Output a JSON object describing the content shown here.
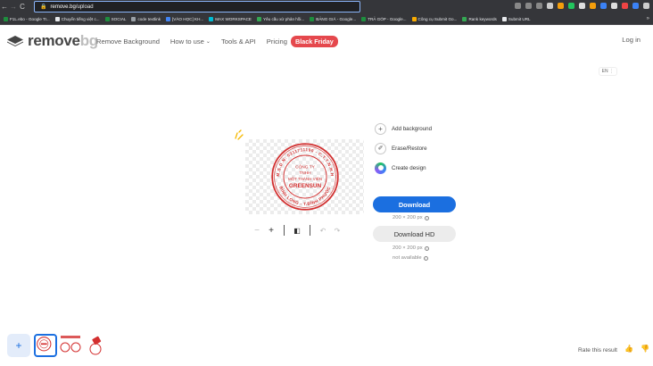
{
  "browser": {
    "url_host": "remove.bg",
    "url_path": "/upload",
    "bookmarks": [
      {
        "label": "F1L.ebo - Google Tr...",
        "color": "#1e8e3e"
      },
      {
        "label": "Chuyển tiếng việt c...",
        "color": "#e8eaed"
      },
      {
        "label": "SOCIAL",
        "color": "#1e8e3e"
      },
      {
        "label": "code textlink",
        "color": "#9aa0a6"
      },
      {
        "label": "[VÀO HỌC] KH...",
        "color": "#4285f4"
      },
      {
        "label": "MAX WORKSPACE",
        "color": "#00bcd4"
      },
      {
        "label": "Yêu cầu xử phản hồi...",
        "color": "#34a853"
      },
      {
        "label": "BẢNG GIÁ - Google...",
        "color": "#1e8e3e"
      },
      {
        "label": "TRẢ GÓP - Google...",
        "color": "#1e8e3e"
      },
      {
        "label": "Công cụ Submit Go...",
        "color": "#f9ab00"
      },
      {
        "label": "Rank keywords",
        "color": "#34a853"
      },
      {
        "label": "Submit URL",
        "color": "#e8eaed"
      }
    ]
  },
  "header": {
    "logo_main": "remove",
    "logo_suffix": "bg",
    "nav": [
      "Remove Background",
      "How to use",
      "Tools & API",
      "Pricing"
    ],
    "badge": "Black Friday",
    "login": "Log in",
    "lang": "EN"
  },
  "stamp": {
    "line1": "CÔNG TY",
    "line2": "TNHH",
    "line3": "MỘT THÀNH VIÊN",
    "line4": "GREENSUN",
    "ring_top": "M.S.D.N: 0311711190 - C.T.T.N.H.H",
    "ring_bottom": "BÌNH LONG - T.BÌNH PHƯỚC",
    "color": "#d32f2f"
  },
  "options": {
    "add_background": "Add background",
    "erase_restore": "Erase/Restore",
    "create_design": "Create design"
  },
  "download": {
    "label": "Download",
    "resolution": "200 × 200 px",
    "hd_label": "Download HD",
    "hd_resolution": "200 × 200 px",
    "hd_note": "not available"
  },
  "footer": {
    "rate_label": "Rate this result"
  },
  "colors": {
    "primary": "#1b6fe0",
    "badge": "#e5484d"
  }
}
